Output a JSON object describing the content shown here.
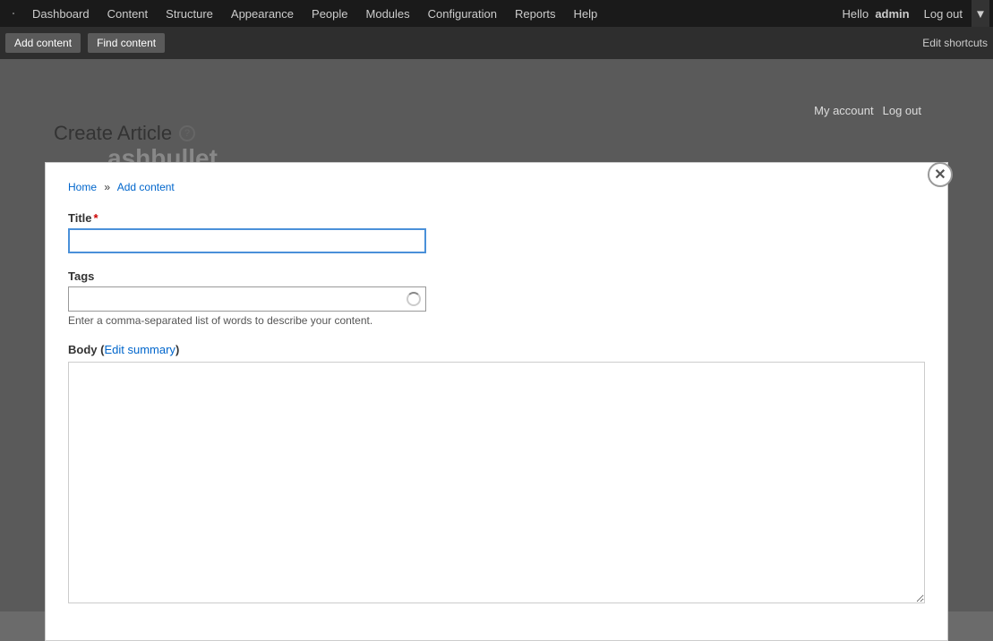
{
  "nav": {
    "items": [
      {
        "label": "Dashboard",
        "name": "nav-dashboard"
      },
      {
        "label": "Content",
        "name": "nav-content"
      },
      {
        "label": "Structure",
        "name": "nav-structure"
      },
      {
        "label": "Appearance",
        "name": "nav-appearance"
      },
      {
        "label": "People",
        "name": "nav-people"
      },
      {
        "label": "Modules",
        "name": "nav-modules"
      },
      {
        "label": "Configuration",
        "name": "nav-configuration"
      },
      {
        "label": "Reports",
        "name": "nav-reports"
      },
      {
        "label": "Help",
        "name": "nav-help"
      }
    ],
    "hello_prefix": "Hello",
    "username": "admin",
    "logout_label": "Log out"
  },
  "toolbar": {
    "add_content_label": "Add content",
    "find_content_label": "Find content",
    "edit_shortcuts_label": "Edit shortcuts"
  },
  "account_bar": {
    "my_account_label": "My account",
    "log_out_label": "Log out"
  },
  "watermark": {
    "text": "ashbullet"
  },
  "page": {
    "title": "Create Article",
    "breadcrumb": {
      "home_label": "Home",
      "separator": "»",
      "add_content_label": "Add content"
    }
  },
  "form": {
    "title_label": "Title",
    "title_required": "*",
    "title_placeholder": "",
    "tags_label": "Tags",
    "tags_placeholder": "",
    "tags_hint": "Enter a comma-separated list of words to describe your content.",
    "body_label": "Body",
    "body_paren_open": "(",
    "edit_summary_label": "Edit summary",
    "body_paren_close": ")"
  },
  "colors": {
    "accent_blue": "#4a90d9",
    "link_blue": "#0066cc",
    "required_red": "#cc0000",
    "nav_bg": "#1a1a1a",
    "toolbar_bg": "#2e2e2e"
  }
}
